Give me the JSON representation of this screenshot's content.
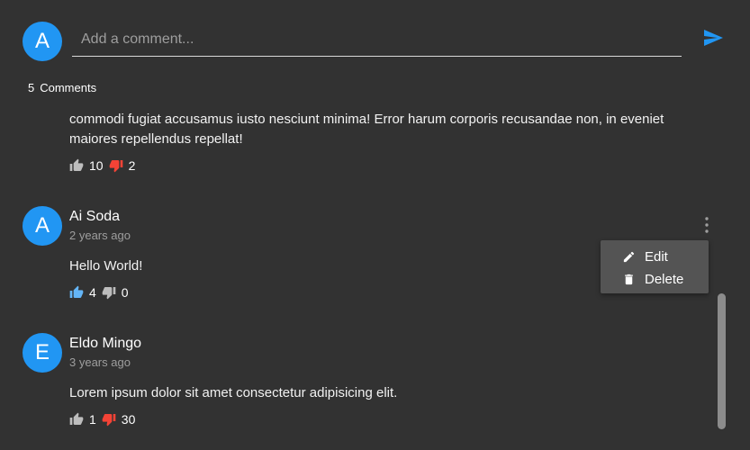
{
  "composer": {
    "avatar_initial": "A",
    "placeholder": "Add a comment..."
  },
  "comments_header": {
    "count": "5",
    "label": "Comments"
  },
  "comments": [
    {
      "text": "commodi fugiat accusamus iusto nesciunt minima! Error harum corporis recusandae non, in eveniet maiores repellendus repellat!",
      "likes": "10",
      "dislikes": "2",
      "liked": false,
      "disliked": true
    },
    {
      "avatar_initial": "A",
      "author": "Ai Soda",
      "time": "2 years ago",
      "text": "Hello World!",
      "likes": "4",
      "dislikes": "0",
      "liked": true,
      "disliked": false
    },
    {
      "avatar_initial": "E",
      "author": "Eldo Mingo",
      "time": "3 years ago",
      "text": "Lorem ipsum dolor sit amet consectetur adipisicing elit.",
      "likes": "1",
      "dislikes": "30",
      "liked": false,
      "disliked": true
    }
  ],
  "menu": {
    "edit_label": "Edit",
    "delete_label": "Delete"
  },
  "colors": {
    "accent": "#2196f3",
    "like_active": "#64b5f6",
    "dislike_active": "#f44336",
    "icon_inactive": "#bdbdbd"
  }
}
